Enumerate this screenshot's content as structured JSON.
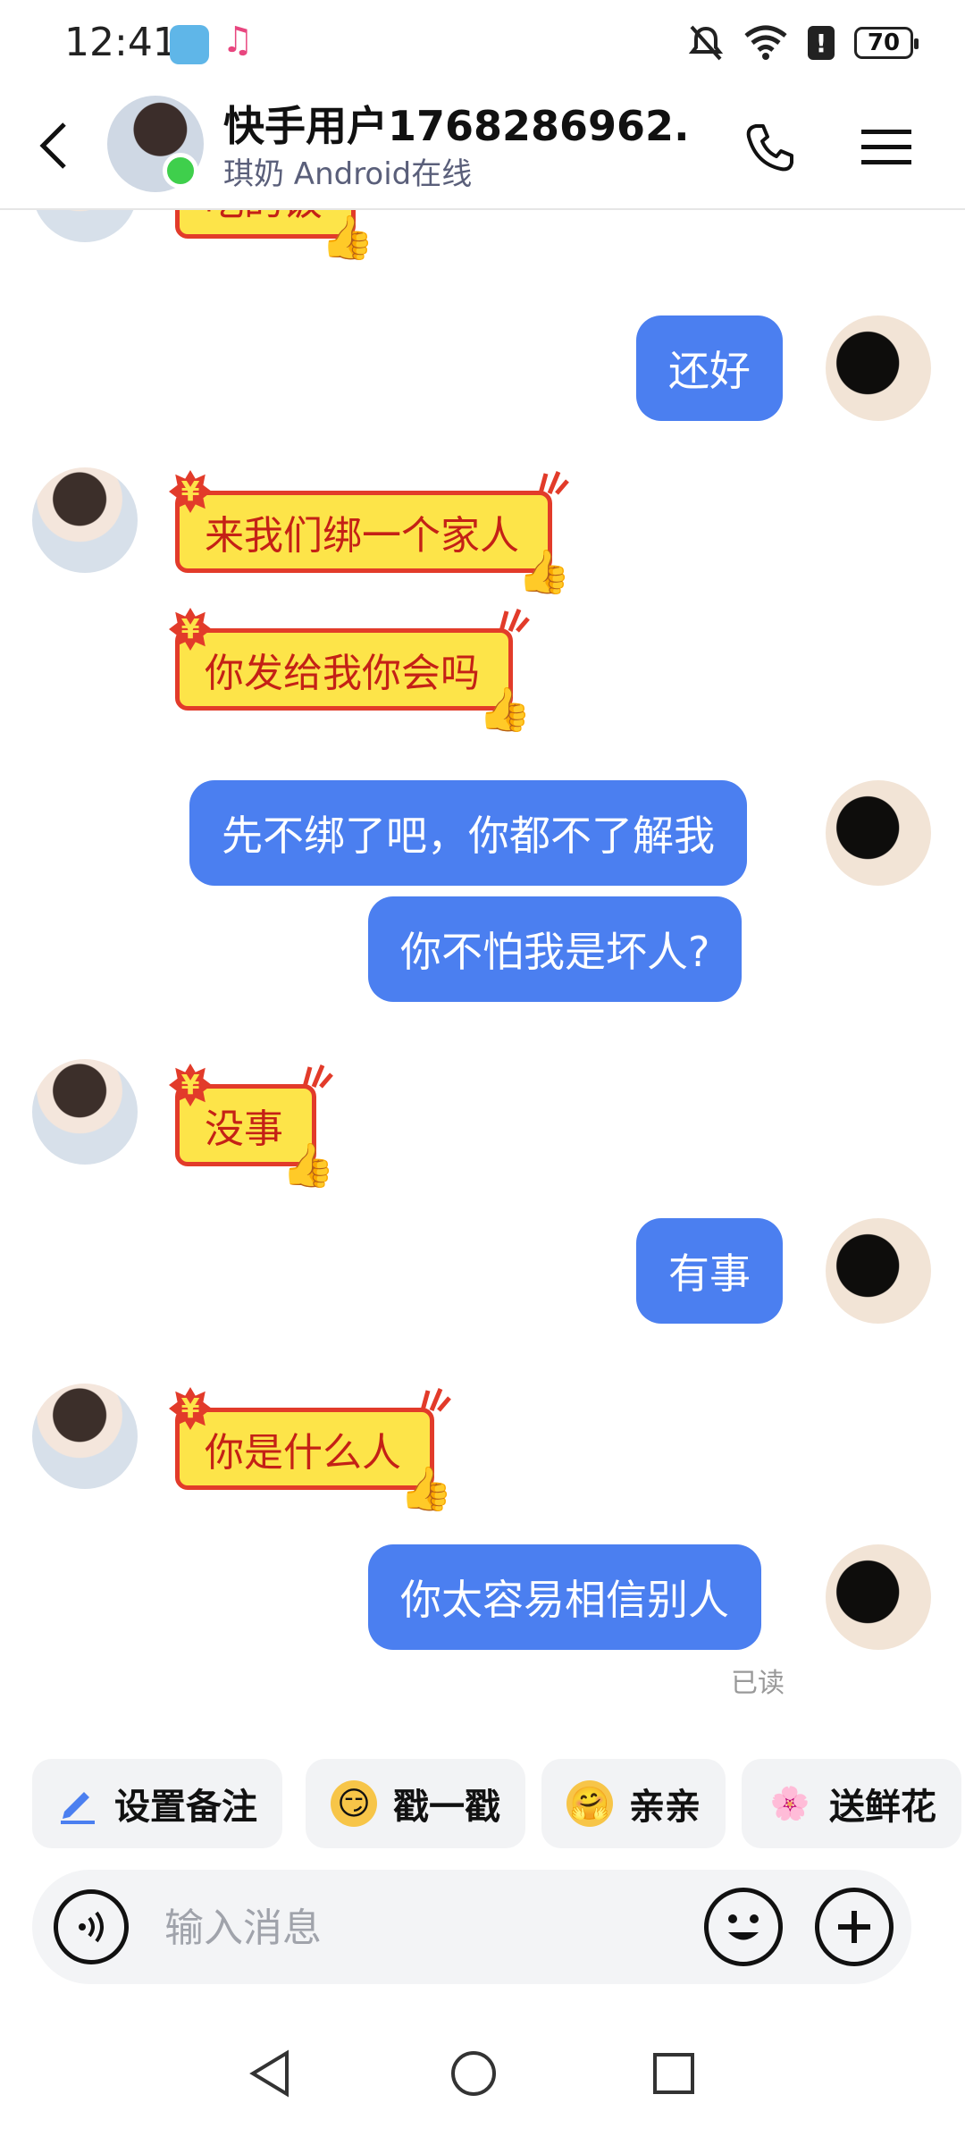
{
  "status_bar": {
    "time": "12:41",
    "battery": "70"
  },
  "header": {
    "contact_name": "快手用户1768286962...",
    "contact_status": "琪奶 Android在线",
    "back_icon": "back-arrow-icon",
    "call_icon": "phone-icon",
    "menu_icon": "hamburger-menu-icon"
  },
  "messages": [
    {
      "side": "peer",
      "type": "sticker",
      "text": "吃的饭"
    },
    {
      "side": "self",
      "type": "text",
      "text": "还好"
    },
    {
      "side": "peer",
      "type": "sticker",
      "text": "来我们绑一个家人"
    },
    {
      "side": "peer",
      "type": "sticker",
      "text": "你发给我你会吗"
    },
    {
      "side": "self",
      "type": "text",
      "text": "先不绑了吧，你都不了解我"
    },
    {
      "side": "self",
      "type": "text",
      "text": "你不怕我是坏人?"
    },
    {
      "side": "peer",
      "type": "sticker",
      "text": "没事"
    },
    {
      "side": "self",
      "type": "text",
      "text": "有事"
    },
    {
      "side": "peer",
      "type": "sticker",
      "text": "你是什么人"
    },
    {
      "side": "self",
      "type": "text",
      "text": "你太容易相信别人"
    }
  ],
  "read_receipt": "已读",
  "sticker_symbol": "¥",
  "quick_actions": [
    {
      "label": "设置备注",
      "icon": "pencil-icon"
    },
    {
      "label": "戳一戳",
      "icon": "poke-emoji-icon"
    },
    {
      "label": "亲亲",
      "icon": "kiss-emoji-icon"
    },
    {
      "label": "送鲜花",
      "icon": "flower-icon"
    }
  ],
  "input": {
    "placeholder": "输入消息"
  },
  "colors": {
    "self_bubble": "#4b7ff0",
    "sticker_bg": "#fde449",
    "sticker_border": "#e23b2a",
    "online": "#3fcf4c"
  }
}
